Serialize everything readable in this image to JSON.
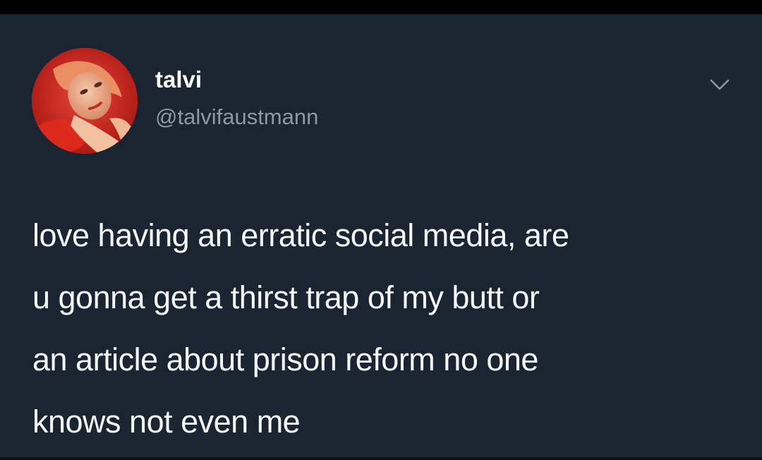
{
  "tweet": {
    "author": {
      "display_name": "talvi",
      "handle": "@talvifaustmann"
    },
    "text_lines": [
      "love having an erratic social media, are",
      "u gonna get a thirst trap of my butt or",
      "an article about prison reform no one",
      "knows not even me"
    ],
    "menu_icon": "chevron-down-icon"
  },
  "colors": {
    "background": "#1b2532",
    "text": "#f5f8fa",
    "handle": "#8b98a5",
    "avatar_accent": "#c8251c"
  }
}
